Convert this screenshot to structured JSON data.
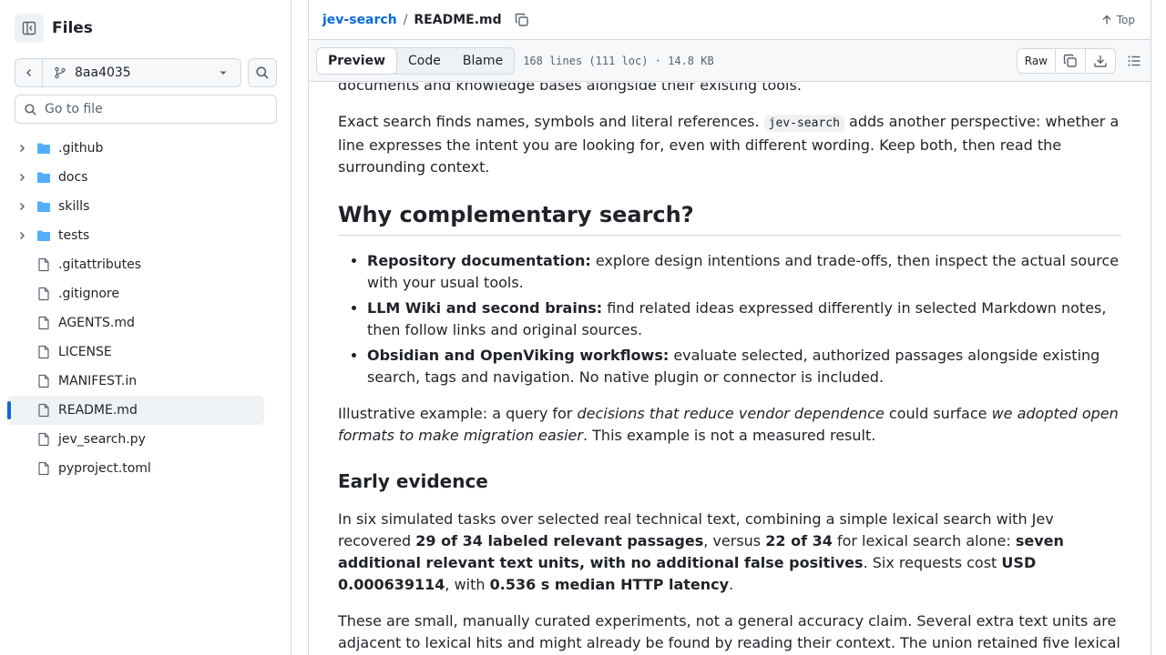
{
  "sidebar": {
    "title": "Files",
    "branch": "8aa4035",
    "goto_placeholder": "Go to file",
    "items": [
      {
        "name": ".github",
        "type": "folder"
      },
      {
        "name": "docs",
        "type": "folder"
      },
      {
        "name": "skills",
        "type": "folder"
      },
      {
        "name": "tests",
        "type": "folder"
      },
      {
        "name": ".gitattributes",
        "type": "file"
      },
      {
        "name": ".gitignore",
        "type": "file"
      },
      {
        "name": "AGENTS.md",
        "type": "file"
      },
      {
        "name": "LICENSE",
        "type": "file"
      },
      {
        "name": "MANIFEST.in",
        "type": "file"
      },
      {
        "name": "README.md",
        "type": "file",
        "selected": true
      },
      {
        "name": "jev_search.py",
        "type": "file"
      },
      {
        "name": "pyproject.toml",
        "type": "file"
      }
    ]
  },
  "header": {
    "repo": "jev-search",
    "separator": "/",
    "file": "README.md",
    "top_label": "Top"
  },
  "filebar": {
    "tabs": [
      "Preview",
      "Code",
      "Blame"
    ],
    "active_tab": "Preview",
    "meta": "168 lines (111 loc) · 14.8 KB",
    "raw_label": "Raw"
  },
  "content": {
    "p0": "documents and knowledge bases alongside their existing tools.",
    "p1_a": "Exact search finds names, symbols and literal references. ",
    "p1_code": "jev-search",
    "p1_b": " adds another perspective: whether a line expresses the intent you are looking for, even with different wording. Keep both, then read the surrounding context.",
    "h2": "Why complementary search?",
    "bullets": [
      {
        "bold": "Repository documentation:",
        "text": " explore design intentions and trade-offs, then inspect the actual source with your usual tools."
      },
      {
        "bold": "LLM Wiki and second brains:",
        "text": " find related ideas expressed differently in selected Markdown notes, then follow links and original sources."
      },
      {
        "bold": "Obsidian and OpenViking workflows:",
        "text": " evaluate selected, authorized passages alongside existing search, tags and navigation. No native plugin or connector is included."
      }
    ],
    "p2_a": "Illustrative example: a query for ",
    "p2_em1": "decisions that reduce vendor dependence",
    "p2_b": " could surface ",
    "p2_em2": "we adopted open formats to make migration easier",
    "p2_c": ". This example is not a measured result.",
    "h3": "Early evidence",
    "p3_a": "In six simulated tasks over selected real technical text, combining a simple lexical search with Jev recovered ",
    "p3_b1": "29 of 34 labeled relevant passages",
    "p3_b": ", versus ",
    "p3_b2": "22 of 34",
    "p3_c": " for lexical search alone: ",
    "p3_b3": "seven additional relevant text units, with no additional false positives",
    "p3_d": ". Six requests cost ",
    "p3_b4": "USD 0.000639114",
    "p3_e": ", with ",
    "p3_b5": "0.536 s median HTTP latency",
    "p3_f": ".",
    "p4": "These are small, manually curated experiments, not a general accuracy claim. Several extra text units are adjacent to lexical hits and might already be found by reading their context. The union retained five lexical"
  },
  "colors": {
    "link": "#0969da",
    "folder": "#54aeff",
    "border": "#d1d9e0",
    "muted": "#59636e"
  }
}
